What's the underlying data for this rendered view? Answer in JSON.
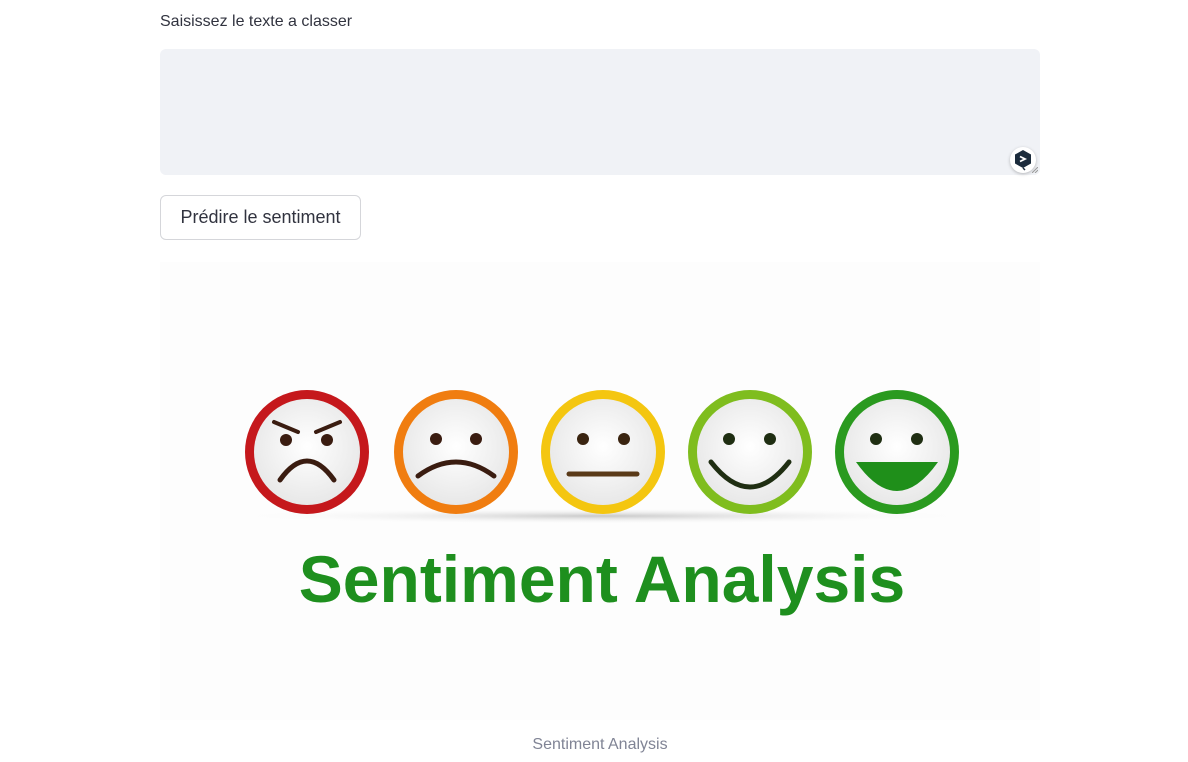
{
  "form": {
    "label": "Saisissez le texte a classer",
    "textarea_value": "",
    "predict_button_label": "Prédire le sentiment"
  },
  "image": {
    "banner_text": "Sentiment Analysis",
    "caption": "Sentiment Analysis",
    "faces": [
      {
        "mood": "angry",
        "ring_color": "#d4201f"
      },
      {
        "mood": "sad",
        "ring_color": "#f07d10"
      },
      {
        "mood": "neutral",
        "ring_color": "#f4c610"
      },
      {
        "mood": "happy",
        "ring_color": "#7fbd1e"
      },
      {
        "mood": "very-happy",
        "ring_color": "#2a9a1f"
      }
    ],
    "text_color": "#1e8f1e"
  },
  "icons": {
    "extension_badge": "grammar-extension-icon"
  }
}
